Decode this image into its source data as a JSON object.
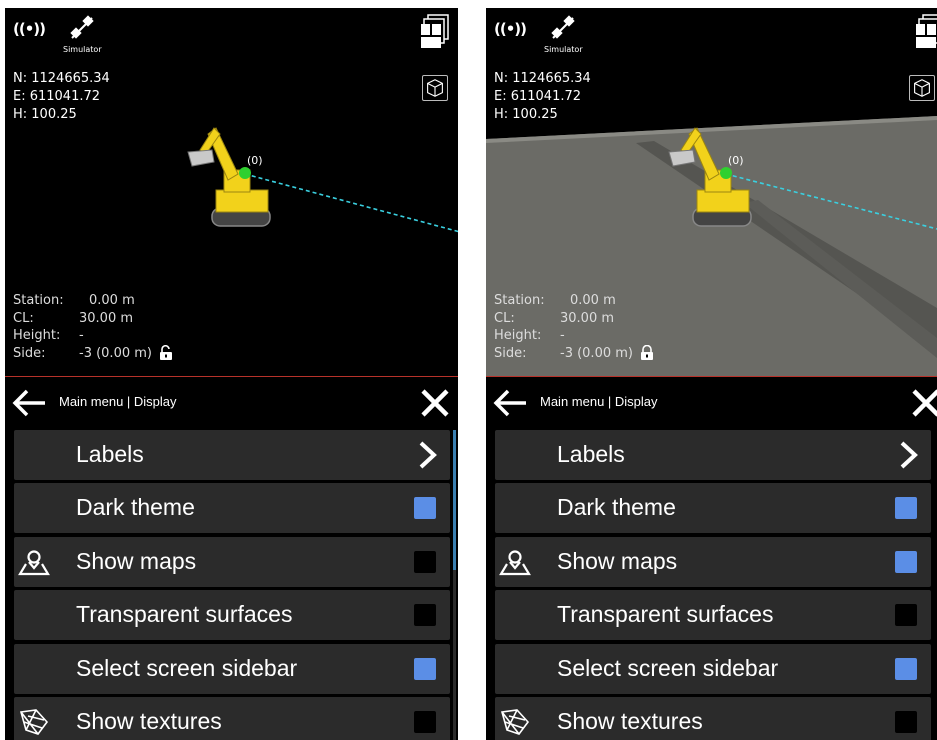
{
  "panels": [
    {
      "id": "left",
      "status": {
        "signal_icon": "wireless-signal-icon",
        "signal_glyph": "((•))",
        "satellite_icon": "satellite-icon",
        "simulator_label": "Simulator"
      },
      "coords": {
        "n": "N: 1124665.34",
        "e": "E: 611041.72",
        "h": "H: 100.25"
      },
      "target_label": "(0)",
      "info": {
        "station_label": "Station:",
        "station_value": "0.00 m",
        "cl_label": "CL:",
        "cl_value": "30.00 m",
        "height_label": "Height:",
        "height_value": "-",
        "side_label": "Side:",
        "side_value": "-3 (0.00 m)"
      },
      "lock_state": "unlocked",
      "show_maps": false,
      "header": {
        "breadcrumb": "Main menu | Display"
      },
      "items": [
        {
          "label": "Labels",
          "type": "submenu",
          "icon": null
        },
        {
          "label": "Dark theme",
          "type": "checkbox",
          "checked": true,
          "icon": null
        },
        {
          "label": "Show maps",
          "type": "checkbox",
          "checked": false,
          "icon": "map-pin-icon"
        },
        {
          "label": "Transparent surfaces",
          "type": "checkbox",
          "checked": false,
          "icon": null
        },
        {
          "label": "Select screen sidebar",
          "type": "checkbox",
          "checked": true,
          "icon": null
        },
        {
          "label": "Show textures",
          "type": "checkbox",
          "checked": false,
          "icon": "texture-icon"
        }
      ],
      "scrollbar_visible": true
    },
    {
      "id": "right",
      "status": {
        "signal_icon": "wireless-signal-icon",
        "signal_glyph": "((•))",
        "satellite_icon": "satellite-icon",
        "simulator_label": "Simulator"
      },
      "coords": {
        "n": "N: 1124665.34",
        "e": "E: 611041.72",
        "h": "H: 100.25"
      },
      "target_label": "(0)",
      "info": {
        "station_label": "Station:",
        "station_value": "0.00 m",
        "cl_label": "CL:",
        "cl_value": "30.00 m",
        "height_label": "Height:",
        "height_value": "-",
        "side_label": "Side:",
        "side_value": "-3 (0.00 m)"
      },
      "lock_state": "locked",
      "show_maps": true,
      "header": {
        "breadcrumb": "Main menu | Display"
      },
      "items": [
        {
          "label": "Labels",
          "type": "submenu",
          "icon": null
        },
        {
          "label": "Dark theme",
          "type": "checkbox",
          "checked": true,
          "icon": null
        },
        {
          "label": "Show maps",
          "type": "checkbox",
          "checked": true,
          "icon": "map-pin-icon"
        },
        {
          "label": "Transparent surfaces",
          "type": "checkbox",
          "checked": false,
          "icon": null
        },
        {
          "label": "Select screen sidebar",
          "type": "checkbox",
          "checked": true,
          "icon": null
        },
        {
          "label": "Show textures",
          "type": "checkbox",
          "checked": false,
          "icon": "texture-icon"
        }
      ],
      "scrollbar_visible": false
    }
  ],
  "colors": {
    "checkbox_on": "#5b8ee6",
    "checkbox_off": "#000000",
    "item_bg": "#2b2b2b",
    "divider": "#b8322a",
    "trace": "#3ad0e0",
    "excavator": "#f2d21b",
    "ground": "#6b6b66"
  }
}
